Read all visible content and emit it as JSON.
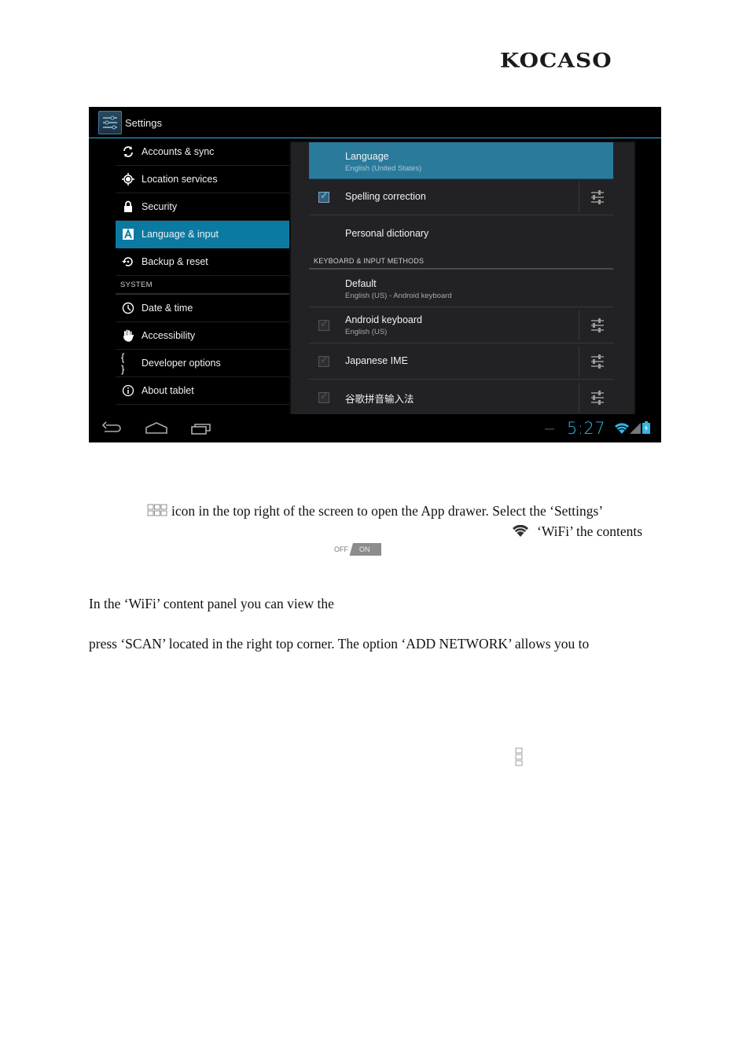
{
  "brand": {
    "logo_text": "KOCASO"
  },
  "screenshot": {
    "action_bar": {
      "title": "Settings",
      "icon": "settings-app-icon"
    },
    "sidebar": {
      "items": [
        {
          "label": "Accounts & sync",
          "icon": "sync-icon",
          "active": false
        },
        {
          "label": "Location services",
          "icon": "location-icon",
          "active": false
        },
        {
          "label": "Security",
          "icon": "lock-icon",
          "active": false
        },
        {
          "label": "Language & input",
          "icon": "language-icon",
          "active": true
        },
        {
          "label": "Backup & reset",
          "icon": "backup-icon",
          "active": false
        }
      ],
      "system_header": "SYSTEM",
      "system_items": [
        {
          "label": "Date & time",
          "icon": "clock-icon"
        },
        {
          "label": "Accessibility",
          "icon": "hand-icon"
        },
        {
          "label": "Developer options",
          "icon": "braces-icon"
        },
        {
          "label": "About tablet",
          "icon": "info-icon"
        }
      ]
    },
    "panel": {
      "language": {
        "title": "Language",
        "subtitle": "English (United States)"
      },
      "spelling": {
        "title": "Spelling correction",
        "checked": true
      },
      "dictionary": {
        "title": "Personal dictionary"
      },
      "section_header": "KEYBOARD & INPUT METHODS",
      "default": {
        "title": "Default",
        "subtitle": "English (US) - Android keyboard"
      },
      "methods": [
        {
          "title": "Android keyboard",
          "subtitle": "English (US)",
          "checked": true,
          "enabled": false
        },
        {
          "title": "Japanese IME",
          "subtitle": "",
          "checked": true,
          "enabled": false
        },
        {
          "title": "谷歌拼音输入法",
          "subtitle": "",
          "checked": true,
          "enabled": false
        }
      ]
    },
    "status_bar": {
      "time": "5:27",
      "wifi": "wifi-icon",
      "signal": "signal-icon",
      "battery": "battery-charging-icon"
    },
    "accent": "#33b5e5",
    "selected_bg": "#0a7aa2"
  },
  "document": {
    "line1": "icon in the top right of the screen to open the App drawer. Select the ‘Settings’",
    "line2": "‘WiFi’ the contents",
    "toggle": {
      "off_label": "OFF",
      "on_label": "ON"
    },
    "line3": "In the ‘WiFi’ content panel you can view the",
    "line4": "press ‘SCAN’ located in the right top corner. The option ‘ADD NETWORK’ allows you to"
  }
}
